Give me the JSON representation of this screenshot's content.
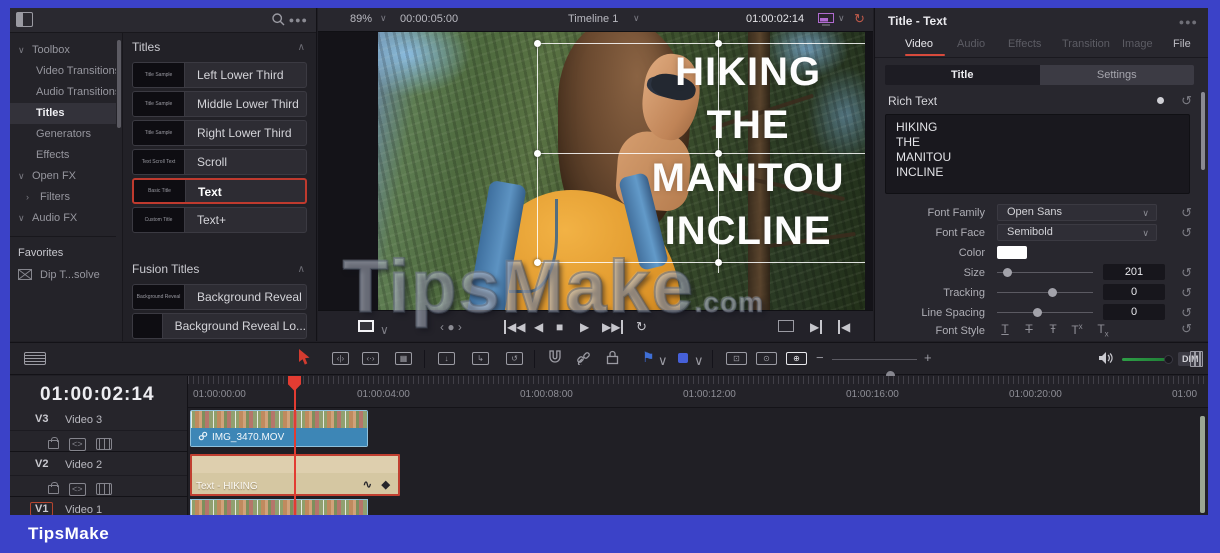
{
  "frame": {
    "footer_brand": "TipsMake",
    "watermark_text": "TipsMake",
    "watermark_suffix": ".com"
  },
  "colors": {
    "frame_blue": "#3b42c8",
    "accent_red": "#d84a3c",
    "selection_red": "#bf3a2e",
    "clip_blue": "#3d86b6",
    "clip_tan": "#d8caa6",
    "volume_green": "#2e9e46"
  },
  "icons": {
    "search": "magnifier",
    "options": "ellipsis",
    "chevron_down": "∨",
    "chevron_up": "∧",
    "chevron_right": "›",
    "reset": "↺",
    "loop": "↻",
    "play": "▶",
    "stop": "■",
    "reverse": "◀",
    "keyframe": "◆",
    "curve": "~"
  },
  "effects_library": {
    "sidebar": {
      "items": [
        {
          "label": "Toolbox"
        },
        {
          "label": "Video Transitions"
        },
        {
          "label": "Audio Transitions"
        },
        {
          "label": "Titles"
        },
        {
          "label": "Generators"
        },
        {
          "label": "Effects"
        },
        {
          "label": "Open FX"
        },
        {
          "label": "Filters"
        },
        {
          "label": "Audio FX"
        }
      ],
      "favorites_label": "Favorites",
      "favorite_item_label": "Dip T...solve"
    },
    "titles_section": {
      "header": "Titles",
      "items": [
        {
          "thumb": "Title Sample",
          "label": "Left Lower Third"
        },
        {
          "thumb": "Title Sample",
          "label": "Middle Lower Third"
        },
        {
          "thumb": "Title Sample",
          "label": "Right Lower Third"
        },
        {
          "thumb": "Text Scroll Text",
          "label": "Scroll"
        },
        {
          "thumb": "Basic Title",
          "label": "Text"
        },
        {
          "thumb": "Custom Title",
          "label": "Text+"
        }
      ]
    },
    "fusion_section": {
      "header": "Fusion Titles",
      "items": [
        {
          "thumb": "Background Reveal",
          "label": "Background Reveal"
        },
        {
          "thumb": "",
          "label": "Background Reveal Lo..."
        }
      ]
    }
  },
  "viewer": {
    "zoom_level": "89%",
    "duration": "00:00:05:00",
    "timeline_name": "Timeline 1",
    "timecode": "01:00:02:14",
    "overlay_lines": [
      "HIKING",
      "THE",
      "MANITOU",
      "INCLINE"
    ]
  },
  "inspector": {
    "title": "Title - Text",
    "tabs": [
      {
        "label": "Video"
      },
      {
        "label": "Audio"
      },
      {
        "label": "Effects"
      },
      {
        "label": "Transition"
      },
      {
        "label": "Image"
      },
      {
        "label": "File"
      }
    ],
    "subtabs": [
      {
        "label": "Title"
      },
      {
        "label": "Settings"
      }
    ],
    "rich_text": {
      "label": "Rich Text",
      "value": "HIKING\nTHE\nMANITOU\nINCLINE"
    },
    "fields": {
      "font_family": {
        "label": "Font Family",
        "value": "Open Sans"
      },
      "font_face": {
        "label": "Font Face",
        "value": "Semibold"
      },
      "color": {
        "label": "Color"
      },
      "size": {
        "label": "Size",
        "value": "201"
      },
      "tracking": {
        "label": "Tracking",
        "value": "0"
      },
      "line_spacing": {
        "label": "Line Spacing",
        "value": "0"
      },
      "font_style": {
        "label": "Font Style"
      }
    }
  },
  "toolbar": {
    "dim_label": "DIM"
  },
  "timeline": {
    "timecode": "01:00:02:14",
    "ruler_labels": [
      "01:00:00:00",
      "01:00:04:00",
      "01:00:08:00",
      "01:00:12:00",
      "01:00:16:00",
      "01:00:20:00",
      "01:00"
    ],
    "tracks": [
      {
        "badge": "V3",
        "name": "Video 3",
        "clip_label": "IMG_3470.MOV"
      },
      {
        "badge": "V2",
        "name": "Video 2",
        "clip_label": "Text - HIKING"
      },
      {
        "badge": "V1",
        "name": "Video 1",
        "clip_label": ""
      }
    ]
  }
}
